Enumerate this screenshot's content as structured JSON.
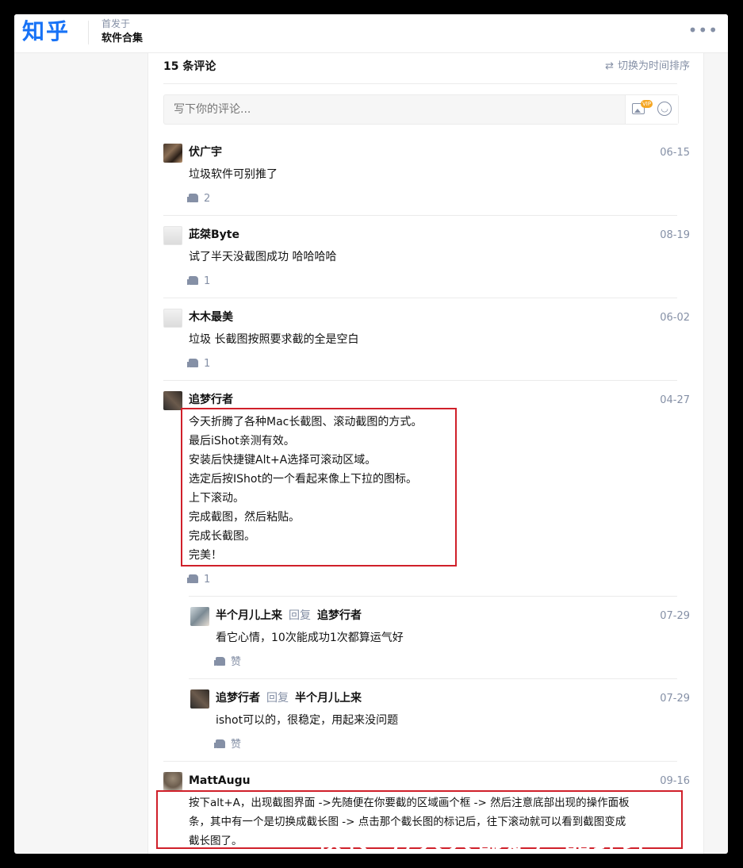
{
  "header": {
    "logo": "知乎",
    "published_in_label": "首发于",
    "column_name": "软件合集",
    "more_icon": "more-dots-icon"
  },
  "comments_section": {
    "count_label": "15 条评论",
    "sort_toggle": "切换为时间排序",
    "input_placeholder": "写下你的评论...",
    "input_vip_badge": "VIP"
  },
  "comments": [
    {
      "author": "伏广宇",
      "date": "06-15",
      "lines": [
        "垃圾软件可别推了"
      ],
      "likes": "2"
    },
    {
      "author": "茈桀Byte",
      "date": "08-19",
      "lines": [
        "试了半天没截图成功 哈哈哈哈"
      ],
      "likes": "1"
    },
    {
      "author": "木木最美",
      "date": "06-02",
      "lines": [
        "垃圾 长截图按照要求截的全是空白"
      ],
      "likes": "1"
    },
    {
      "author": "追梦行者",
      "date": "04-27",
      "lines": [
        "今天折腾了各种Mac长截图、滚动截图的方式。",
        "最后iShot亲测有效。",
        "安装后快捷键Alt+A选择可滚动区域。",
        "选定后按IShot的一个看起来像上下拉的图标。",
        "上下滚动。",
        "完成截图，然后粘贴。",
        "完成长截图。",
        "完美！"
      ],
      "likes": "1",
      "replies": [
        {
          "author": "半个月儿上来",
          "reply_word": "回复",
          "reply_to": "追梦行者",
          "date": "07-29",
          "lines": [
            "看它心情，10次能成功1次都算运气好"
          ],
          "likes": "赞"
        },
        {
          "author": "追梦行者",
          "reply_word": "回复",
          "reply_to": "半个月儿上来",
          "date": "07-29",
          "lines": [
            "ishot可以的，很稳定，用起来没问题"
          ],
          "likes": "赞"
        }
      ]
    },
    {
      "author": "MattAugu",
      "date": "09-16",
      "lines": [
        "按下alt+A，出现截图界面 ->先随便在你要截的区域画个框 -> 然后注意底部出现的操作面板",
        "条，其中有一个是切换成截长图 -> 点击那个截长图的标记后，往下滚动就可以看到截图变成",
        "截长图了。"
      ]
    }
  ],
  "watermark": "侠传号/大大都是产品经理",
  "colors": {
    "brand": "#1772f6",
    "muted": "#8590a6",
    "highlight_box": "#d0202a"
  }
}
